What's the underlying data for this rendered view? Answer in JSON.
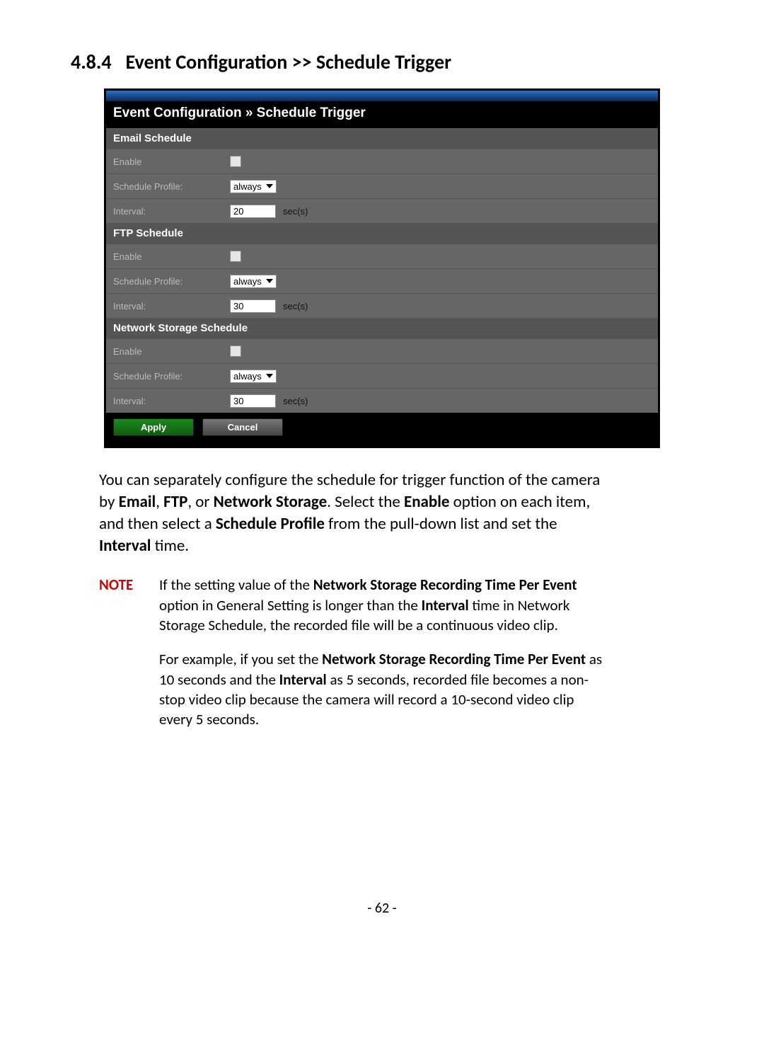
{
  "section": {
    "number": "4.8.4",
    "title": "Event Configuration >> Schedule Trigger"
  },
  "ui": {
    "breadcrumb": "Event Configuration » Schedule Trigger",
    "labels": {
      "enable": "Enable",
      "schedule_profile": "Schedule Profile:",
      "interval": "Interval:",
      "secs": "sec(s)"
    },
    "sections": {
      "email": {
        "header": "Email Schedule",
        "enable": false,
        "profile": "always",
        "interval": "20"
      },
      "ftp": {
        "header": "FTP Schedule",
        "enable": false,
        "profile": "always",
        "interval": "30"
      },
      "ns": {
        "header": "Network Storage Schedule",
        "enable": false,
        "profile": "always",
        "interval": "30"
      }
    },
    "buttons": {
      "apply": "Apply",
      "cancel": "Cancel"
    }
  },
  "text": {
    "para1_a": "You can separately configure the schedule for trigger function of the camera by ",
    "para1_b1": "Email",
    "para1_c": ", ",
    "para1_b2": "FTP",
    "para1_d": ", or ",
    "para1_b3": "Network Storage",
    "para1_e": ". Select the ",
    "para1_b4": "Enable",
    "para1_f": " option on each item, and then select a ",
    "para1_b5": "Schedule Profile",
    "para1_g": " from the pull-down list and set the ",
    "para1_b6": "Interval",
    "para1_h": " time."
  },
  "note": {
    "label": "NOTE",
    "p1_a": "If the setting value of the ",
    "p1_b1": "Network Storage Recording Time Per Event",
    "p1_b": " option in General Setting is longer than the ",
    "p1_b2": "Interval",
    "p1_c": " time in Network Storage Schedule, the recorded file will be a continuous video clip.",
    "p2_a": "For example, if you set the ",
    "p2_b1": "Network Storage Recording Time Per Event",
    "p2_b": " as 10 seconds and the ",
    "p2_b2": "Interval",
    "p2_c": " as 5 seconds, recorded file becomes a non-stop video clip  because the camera will record a 10-second video clip every 5 seconds."
  },
  "page_number": "- 62 -"
}
